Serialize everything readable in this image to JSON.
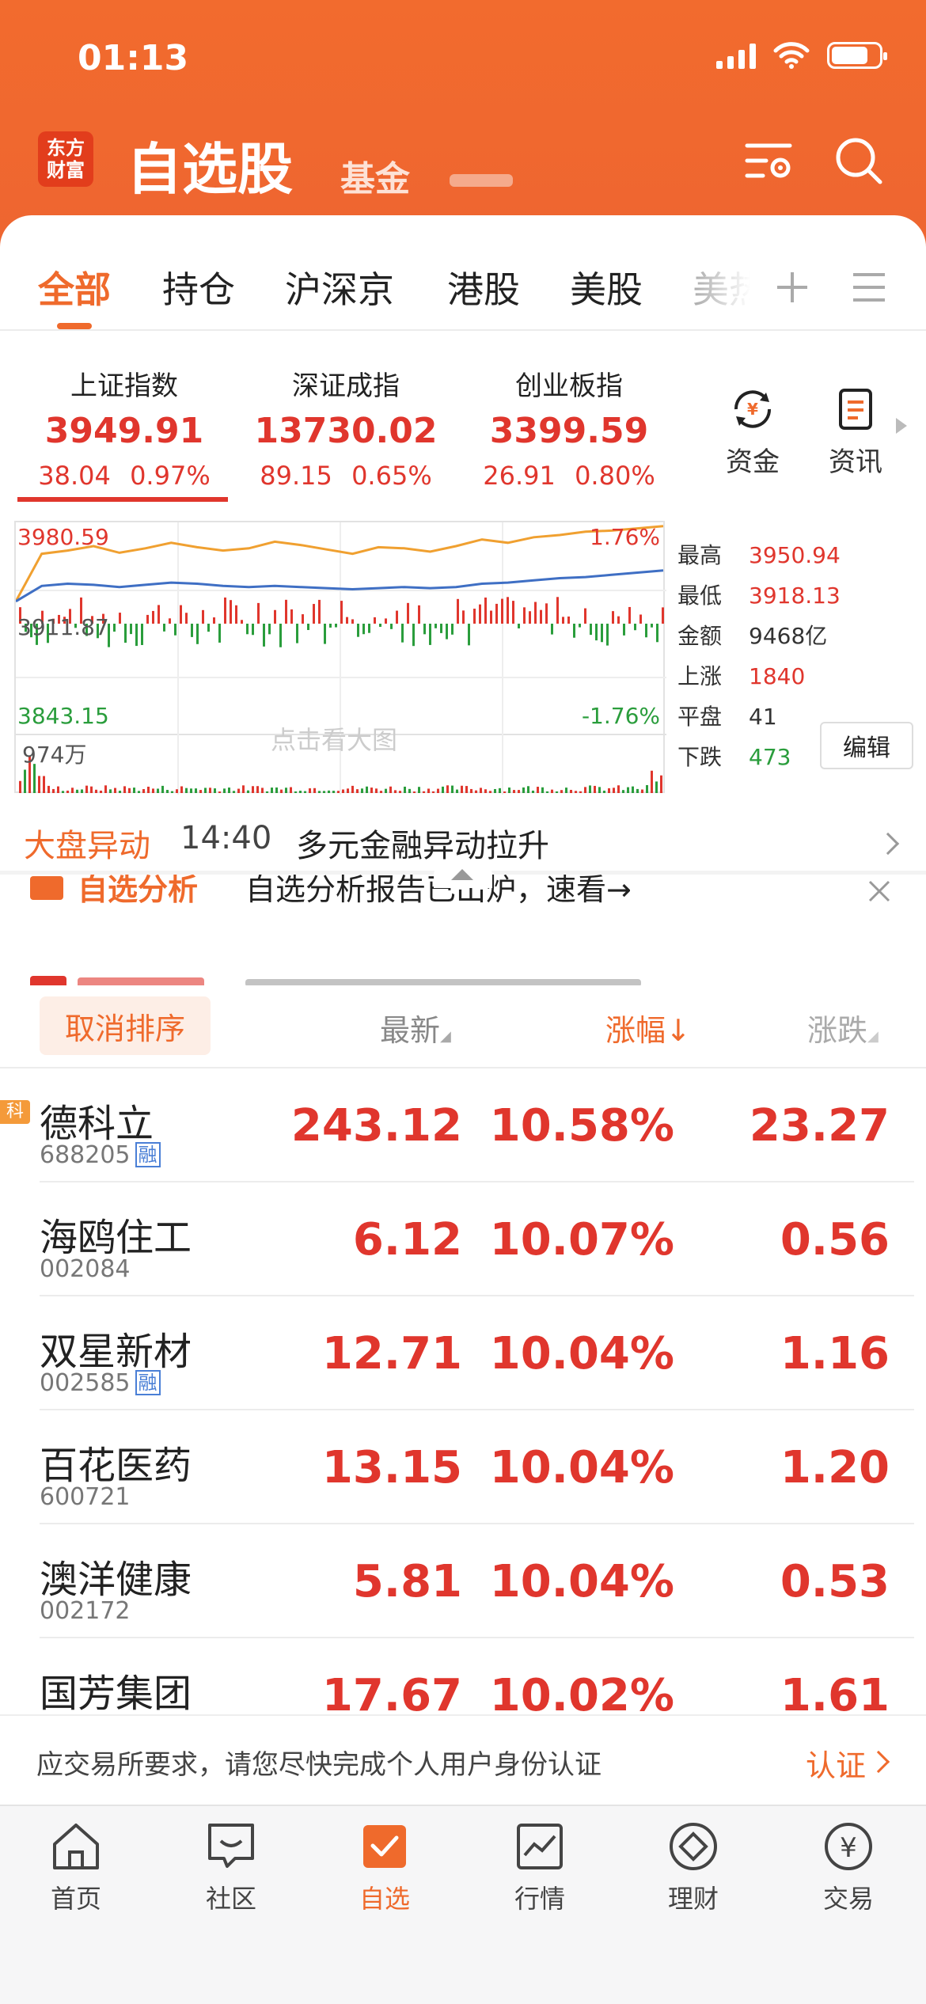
{
  "status": {
    "time": "01:13"
  },
  "header": {
    "logo_line1": "东方",
    "logo_line2": "财富",
    "title": "自选股",
    "tab2": "基金",
    "settings_icon": "list-settings-icon",
    "search_icon": "search-icon"
  },
  "categories": [
    {
      "label": "全部",
      "active": true
    },
    {
      "label": "持仓"
    },
    {
      "label": "沪深京"
    },
    {
      "label": "港股"
    },
    {
      "label": "美股"
    },
    {
      "label": "美热"
    }
  ],
  "indices": [
    {
      "name": "上证指数",
      "value": "3949.91",
      "change": "38.04 0.97%"
    },
    {
      "name": "深证成指",
      "value": "13730.02",
      "change": "89.15 0.65%"
    },
    {
      "name": "创业板指",
      "value": "3399.59",
      "change": "26.91 0.80%"
    }
  ],
  "side_buttons": {
    "funds": "资金",
    "news": "资讯"
  },
  "chart": {
    "high_label": "3980.59",
    "mid_label": "3911.87",
    "low_label": "3843.15",
    "pct_high": "1.76%",
    "pct_low": "-1.76%",
    "volume_label": "974万",
    "watermark": "点击看大图"
  },
  "chart_data": {
    "type": "line",
    "ylim": [
      3843.15,
      3980.59
    ],
    "series": [
      {
        "values": [
          3912,
          3955,
          3958,
          3962,
          3956,
          3960,
          3965,
          3961,
          3958,
          3960,
          3966,
          3963,
          3959,
          3955,
          3961,
          3960,
          3957,
          3962,
          3968,
          3965,
          3970,
          3972,
          3975,
          3976,
          3978,
          3980
        ]
      },
      {
        "values": [
          3912,
          3926,
          3928,
          3927,
          3925,
          3927,
          3929,
          3928,
          3926,
          3925,
          3926,
          3925,
          3924,
          3923,
          3924,
          3925,
          3924,
          3925,
          3928,
          3929,
          3931,
          3933,
          3934,
          3936,
          3938,
          3940
        ]
      }
    ],
    "colors": [
      "#f0a030",
      "#3f6fc4"
    ]
  },
  "stats": [
    {
      "key": "最高",
      "value": "3950.94",
      "color": "#e0362d"
    },
    {
      "key": "最低",
      "value": "3918.13",
      "color": "#e0362d"
    },
    {
      "key": "金额",
      "value": "9468亿",
      "color": "#333333"
    },
    {
      "key": "上涨",
      "value": "1840",
      "color": "#e0362d"
    },
    {
      "key": "平盘",
      "value": "41",
      "color": "#333333"
    },
    {
      "key": "下跌",
      "value": "473",
      "color": "#2a9d3c"
    }
  ],
  "edit_label": "编辑",
  "market": {
    "title": "大盘异动",
    "time": "14:40",
    "text": "多元金融异动拉升"
  },
  "banner": {
    "title": "自选分析",
    "text": "自选分析报告已出炉，速看→"
  },
  "sort": {
    "cancel": "取消排序",
    "col_latest": "最新",
    "col_pct": "涨幅↓",
    "col_change": "涨跌"
  },
  "stocks": [
    {
      "name": "德科立",
      "code": "688205",
      "rong": "融",
      "latest": "243.12",
      "pct": "10.58%",
      "change": "23.27",
      "badge": "科"
    },
    {
      "name": "海鸥住工",
      "code": "002084",
      "latest": "6.12",
      "pct": "10.07%",
      "change": "0.56"
    },
    {
      "name": "双星新材",
      "code": "002585",
      "rong": "融",
      "latest": "12.71",
      "pct": "10.04%",
      "change": "1.16"
    },
    {
      "name": "百花医药",
      "code": "600721",
      "latest": "13.15",
      "pct": "10.04%",
      "change": "1.20"
    },
    {
      "name": "澳洋健康",
      "code": "002172",
      "latest": "5.81",
      "pct": "10.04%",
      "change": "0.53"
    },
    {
      "name": "国芳集团",
      "code": "",
      "latest": "17.67",
      "pct": "10.02%",
      "change": "1.61"
    }
  ],
  "notice": {
    "text": "应交易所要求，请您尽快完成个人用户身份认证",
    "link": "认证"
  },
  "nav": [
    {
      "label": "首页"
    },
    {
      "label": "社区"
    },
    {
      "label": "自选",
      "active": true
    },
    {
      "label": "行情"
    },
    {
      "label": "理财"
    },
    {
      "label": "交易"
    }
  ]
}
